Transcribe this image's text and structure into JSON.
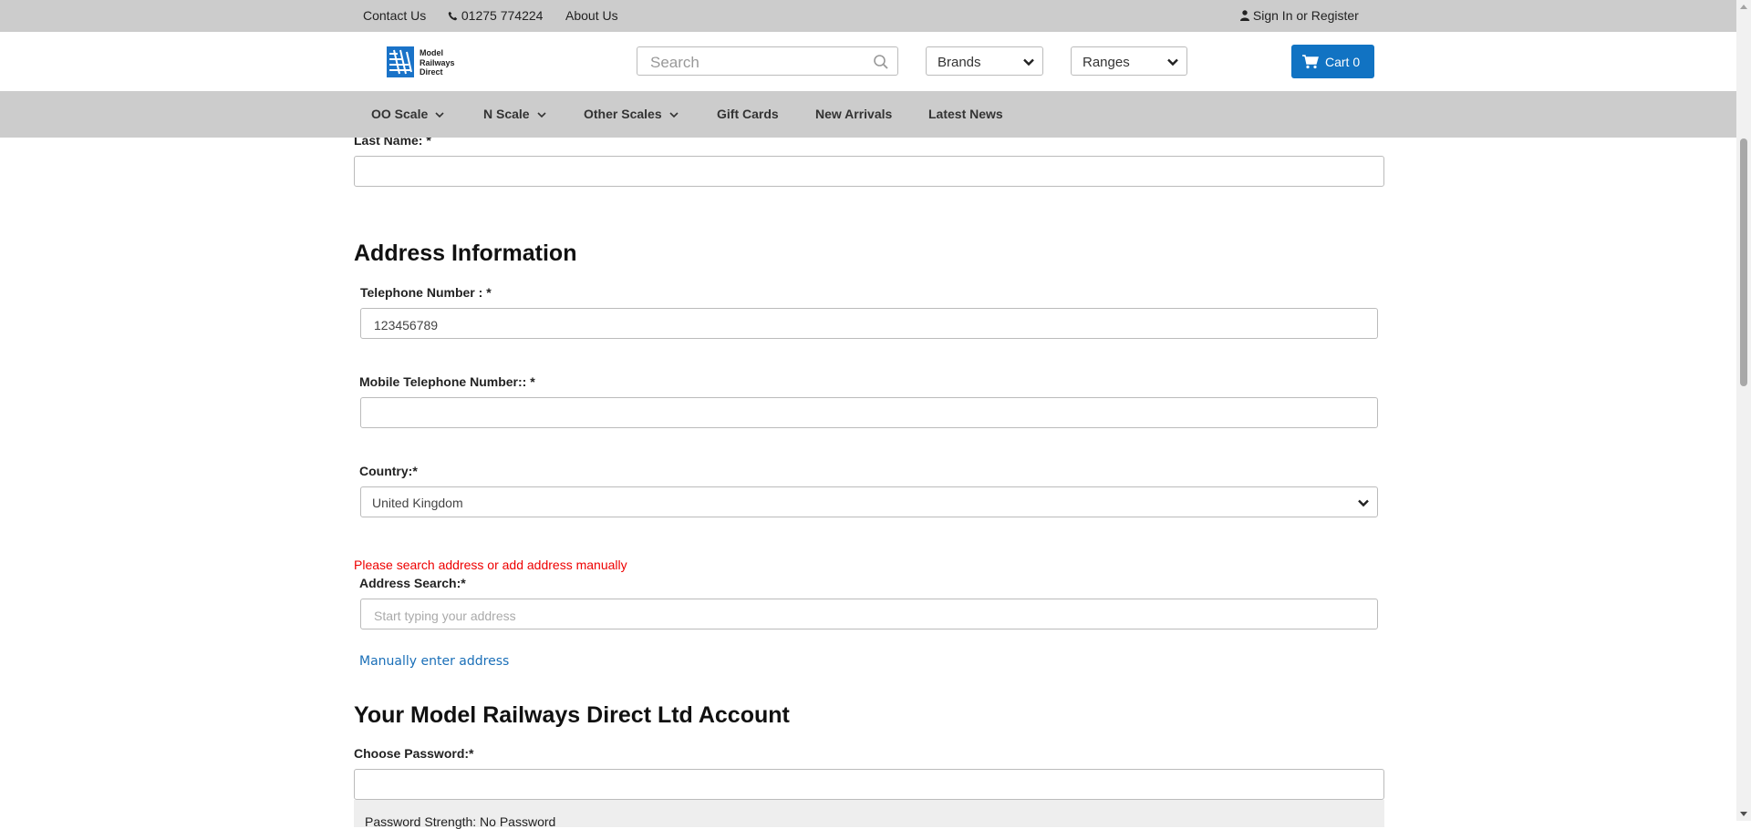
{
  "topbar": {
    "contact": "Contact Us",
    "phone": "01275 774224",
    "about": "About Us",
    "signin": "Sign In or Register"
  },
  "header": {
    "logo_lines": [
      "Model",
      "Railways",
      "Direct"
    ],
    "search_placeholder": "Search",
    "brands_label": "Brands",
    "ranges_label": "Ranges",
    "cart_label": "Cart 0"
  },
  "nav": {
    "items": [
      {
        "label": "OO Scale",
        "dropdown": true
      },
      {
        "label": "N Scale",
        "dropdown": true
      },
      {
        "label": "Other Scales",
        "dropdown": true
      },
      {
        "label": "Gift Cards",
        "dropdown": false
      },
      {
        "label": "New Arrivals",
        "dropdown": false
      },
      {
        "label": "Latest News",
        "dropdown": false
      }
    ]
  },
  "form": {
    "last_name_label": "Last Name:",
    "last_name_value": "",
    "address_heading": "Address Information",
    "telephone_label": "Telephone Number :",
    "telephone_value": "123456789",
    "mobile_label": "Mobile Telephone Number::",
    "mobile_value": "",
    "country_label": "Country:",
    "country_value": "United Kingdom",
    "address_error": "Please search address or add address manually",
    "address_search_label": "Address Search:",
    "address_search_placeholder": "Start typing your address",
    "manual_link": "Manually enter address",
    "account_heading": "Your Model Railways Direct Ltd Account",
    "password_label": "Choose Password:",
    "password_value": "",
    "password_strength": "Password Strength: No Password",
    "required_mark": "*"
  },
  "colors": {
    "bar_bg": "#cccccc",
    "accent": "#1173c3",
    "error": "#ee0000",
    "link": "#1a6fb8"
  }
}
